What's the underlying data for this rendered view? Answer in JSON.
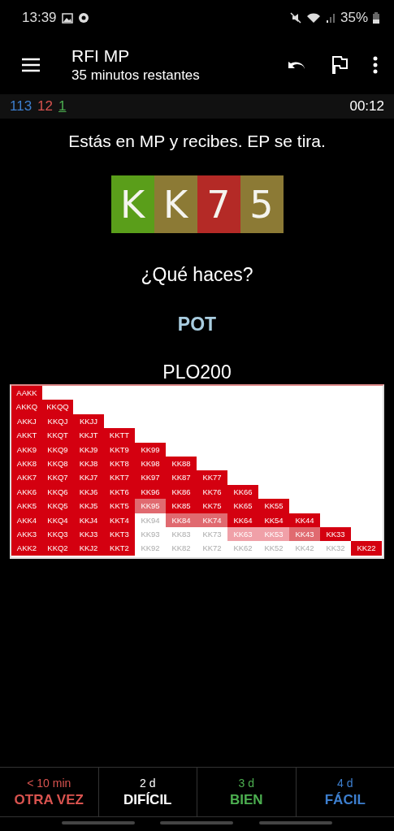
{
  "status_bar": {
    "time": "13:39",
    "battery": "35%"
  },
  "toolbar": {
    "title": "RFI MP",
    "subtitle": "35 minutos restantes"
  },
  "counters": [
    {
      "value": "113",
      "color": "#3d7fcf",
      "underlined": false
    },
    {
      "value": "12",
      "color": "#d9534f",
      "underlined": false
    },
    {
      "value": "1",
      "color": "#4caf50",
      "underlined": true
    }
  ],
  "timer": "00:12",
  "question": "Estás en MP y recibes. EP se tira.",
  "cards": [
    {
      "rank": "K",
      "color": "#5a9e1a"
    },
    {
      "rank": "K",
      "color": "#8c7a35"
    },
    {
      "rank": "7",
      "color": "#b42a26"
    },
    {
      "rank": "5",
      "color": "#8c7a35"
    }
  ],
  "prompt": "¿Qué haces?",
  "answer": "POT",
  "chart_title": "PLO200",
  "range_rows": [
    {
      "cells": [
        {
          "label": "AAKK",
          "kind": "full"
        }
      ]
    },
    {
      "cells": [
        {
          "label": "AKKQ",
          "kind": "full"
        },
        {
          "label": "KKQQ",
          "kind": "full"
        }
      ]
    },
    {
      "cells": [
        {
          "label": "AKKJ",
          "kind": "full"
        },
        {
          "label": "KKQJ",
          "kind": "full"
        },
        {
          "label": "KKJJ",
          "kind": "full"
        }
      ]
    },
    {
      "cells": [
        {
          "label": "AKKT",
          "kind": "full"
        },
        {
          "label": "KKQT",
          "kind": "full"
        },
        {
          "label": "KKJT",
          "kind": "full"
        },
        {
          "label": "KKTT",
          "kind": "full"
        }
      ]
    },
    {
      "cells": [
        {
          "label": "AKK9",
          "kind": "full"
        },
        {
          "label": "KKQ9",
          "kind": "full"
        },
        {
          "label": "KKJ9",
          "kind": "full"
        },
        {
          "label": "KKT9",
          "kind": "full"
        },
        {
          "label": "KK99",
          "kind": "full"
        }
      ]
    },
    {
      "cells": [
        {
          "label": "AKK8",
          "kind": "full"
        },
        {
          "label": "KKQ8",
          "kind": "full"
        },
        {
          "label": "KKJ8",
          "kind": "full"
        },
        {
          "label": "KKT8",
          "kind": "full"
        },
        {
          "label": "KK98",
          "kind": "full"
        },
        {
          "label": "KK88",
          "kind": "full"
        }
      ]
    },
    {
      "cells": [
        {
          "label": "AKK7",
          "kind": "full"
        },
        {
          "label": "KKQ7",
          "kind": "full"
        },
        {
          "label": "KKJ7",
          "kind": "full"
        },
        {
          "label": "KKT7",
          "kind": "full"
        },
        {
          "label": "KK97",
          "kind": "full"
        },
        {
          "label": "KK87",
          "kind": "full"
        },
        {
          "label": "KK77",
          "kind": "full"
        }
      ]
    },
    {
      "cells": [
        {
          "label": "AKK6",
          "kind": "full"
        },
        {
          "label": "KKQ6",
          "kind": "full"
        },
        {
          "label": "KKJ6",
          "kind": "full"
        },
        {
          "label": "KKT6",
          "kind": "full"
        },
        {
          "label": "KK96",
          "kind": "full"
        },
        {
          "label": "KK86",
          "kind": "full"
        },
        {
          "label": "KK76",
          "kind": "full"
        },
        {
          "label": "KK66",
          "kind": "full"
        }
      ]
    },
    {
      "cells": [
        {
          "label": "AKK5",
          "kind": "full"
        },
        {
          "label": "KKQ5",
          "kind": "full"
        },
        {
          "label": "KKJ5",
          "kind": "full"
        },
        {
          "label": "KKT5",
          "kind": "full"
        },
        {
          "label": "KK95",
          "kind": "mixed"
        },
        {
          "label": "KK85",
          "kind": "full"
        },
        {
          "label": "KK75",
          "kind": "full"
        },
        {
          "label": "KK65",
          "kind": "full"
        },
        {
          "label": "KK55",
          "kind": "full"
        }
      ]
    },
    {
      "cells": [
        {
          "label": "AKK4",
          "kind": "full"
        },
        {
          "label": "KKQ4",
          "kind": "full"
        },
        {
          "label": "KKJ4",
          "kind": "full"
        },
        {
          "label": "KKT4",
          "kind": "full"
        },
        {
          "label": "KK94",
          "kind": "none"
        },
        {
          "label": "KK84",
          "kind": "mixed"
        },
        {
          "label": "KK74",
          "kind": "mixed"
        },
        {
          "label": "KK64",
          "kind": "full"
        },
        {
          "label": "KK54",
          "kind": "full"
        },
        {
          "label": "KK44",
          "kind": "full"
        }
      ]
    },
    {
      "cells": [
        {
          "label": "AKK3",
          "kind": "full"
        },
        {
          "label": "KKQ3",
          "kind": "full"
        },
        {
          "label": "KKJ3",
          "kind": "full"
        },
        {
          "label": "KKT3",
          "kind": "full"
        },
        {
          "label": "KK93",
          "kind": "none"
        },
        {
          "label": "KK83",
          "kind": "none"
        },
        {
          "label": "KK73",
          "kind": "none"
        },
        {
          "label": "KK63",
          "kind": "light"
        },
        {
          "label": "KK53",
          "kind": "light"
        },
        {
          "label": "KK43",
          "kind": "mixed"
        },
        {
          "label": "KK33",
          "kind": "full"
        }
      ]
    },
    {
      "cells": [
        {
          "label": "AKK2",
          "kind": "full"
        },
        {
          "label": "KKQ2",
          "kind": "full"
        },
        {
          "label": "KKJ2",
          "kind": "full"
        },
        {
          "label": "KKT2",
          "kind": "full"
        },
        {
          "label": "KK92",
          "kind": "none"
        },
        {
          "label": "KK82",
          "kind": "none"
        },
        {
          "label": "KK72",
          "kind": "none"
        },
        {
          "label": "KK62",
          "kind": "none"
        },
        {
          "label": "KK52",
          "kind": "none"
        },
        {
          "label": "KK42",
          "kind": "none"
        },
        {
          "label": "KK32",
          "kind": "none"
        },
        {
          "label": "KK22",
          "kind": "full"
        }
      ]
    }
  ],
  "answer_buttons": [
    {
      "interval": "< 10 min",
      "label": "OTRA VEZ",
      "color": "#d9534f"
    },
    {
      "interval": "2 d",
      "label": "DIFÍCIL",
      "color": "#ffffff"
    },
    {
      "interval": "3 d",
      "label": "BIEN",
      "color": "#4caf50"
    },
    {
      "interval": "4 d",
      "label": "FÁCIL",
      "color": "#3d7fcf"
    }
  ]
}
